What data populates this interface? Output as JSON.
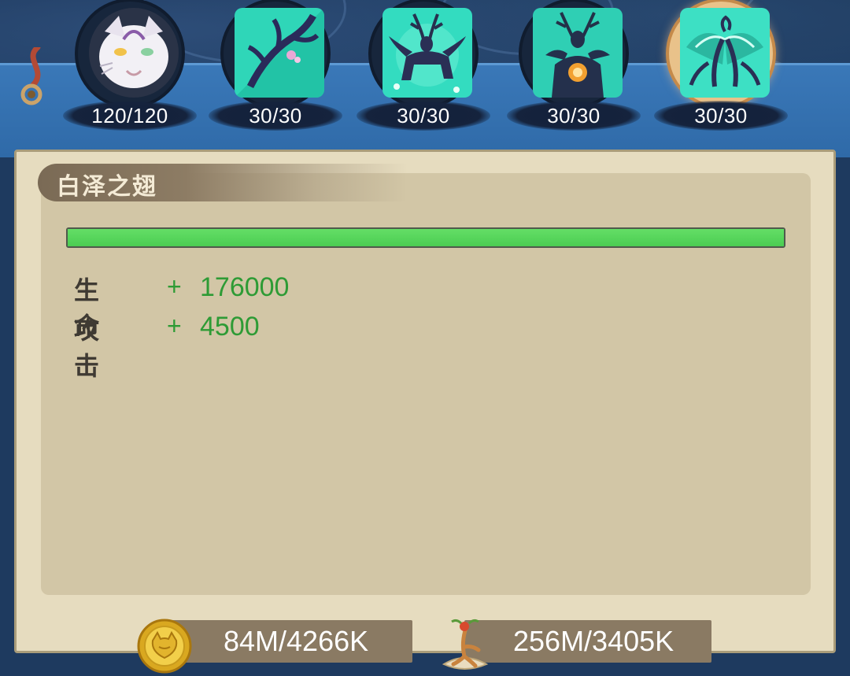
{
  "avatars": [
    {
      "icon": "white-fox-beast-icon",
      "count": "120/120",
      "selected": false
    },
    {
      "icon": "antler-branch-icon",
      "count": "30/30",
      "selected": false
    },
    {
      "icon": "deer-silhouette-icon",
      "count": "30/30",
      "selected": false
    },
    {
      "icon": "deer-orb-icon",
      "count": "30/30",
      "selected": false
    },
    {
      "icon": "jade-wings-icon",
      "count": "30/30",
      "selected": true
    }
  ],
  "panel": {
    "title": "白泽之翅",
    "progress_fraction": 1.0,
    "stats": [
      {
        "label": "生命",
        "plus": "+",
        "value": "176000"
      },
      {
        "label": "攻击",
        "plus": "+",
        "value": "4500"
      }
    ]
  },
  "currencies": [
    {
      "icon": "gold-coin-icon",
      "value": "84M/4266K"
    },
    {
      "icon": "ginseng-herb-icon",
      "value": "256M/3405K"
    }
  ],
  "colors": {
    "progress": "#4bcd52",
    "stat_value": "#2e9b35",
    "panel_bg": "#d2c6a6",
    "frame_blue": "#2f6aa8"
  }
}
